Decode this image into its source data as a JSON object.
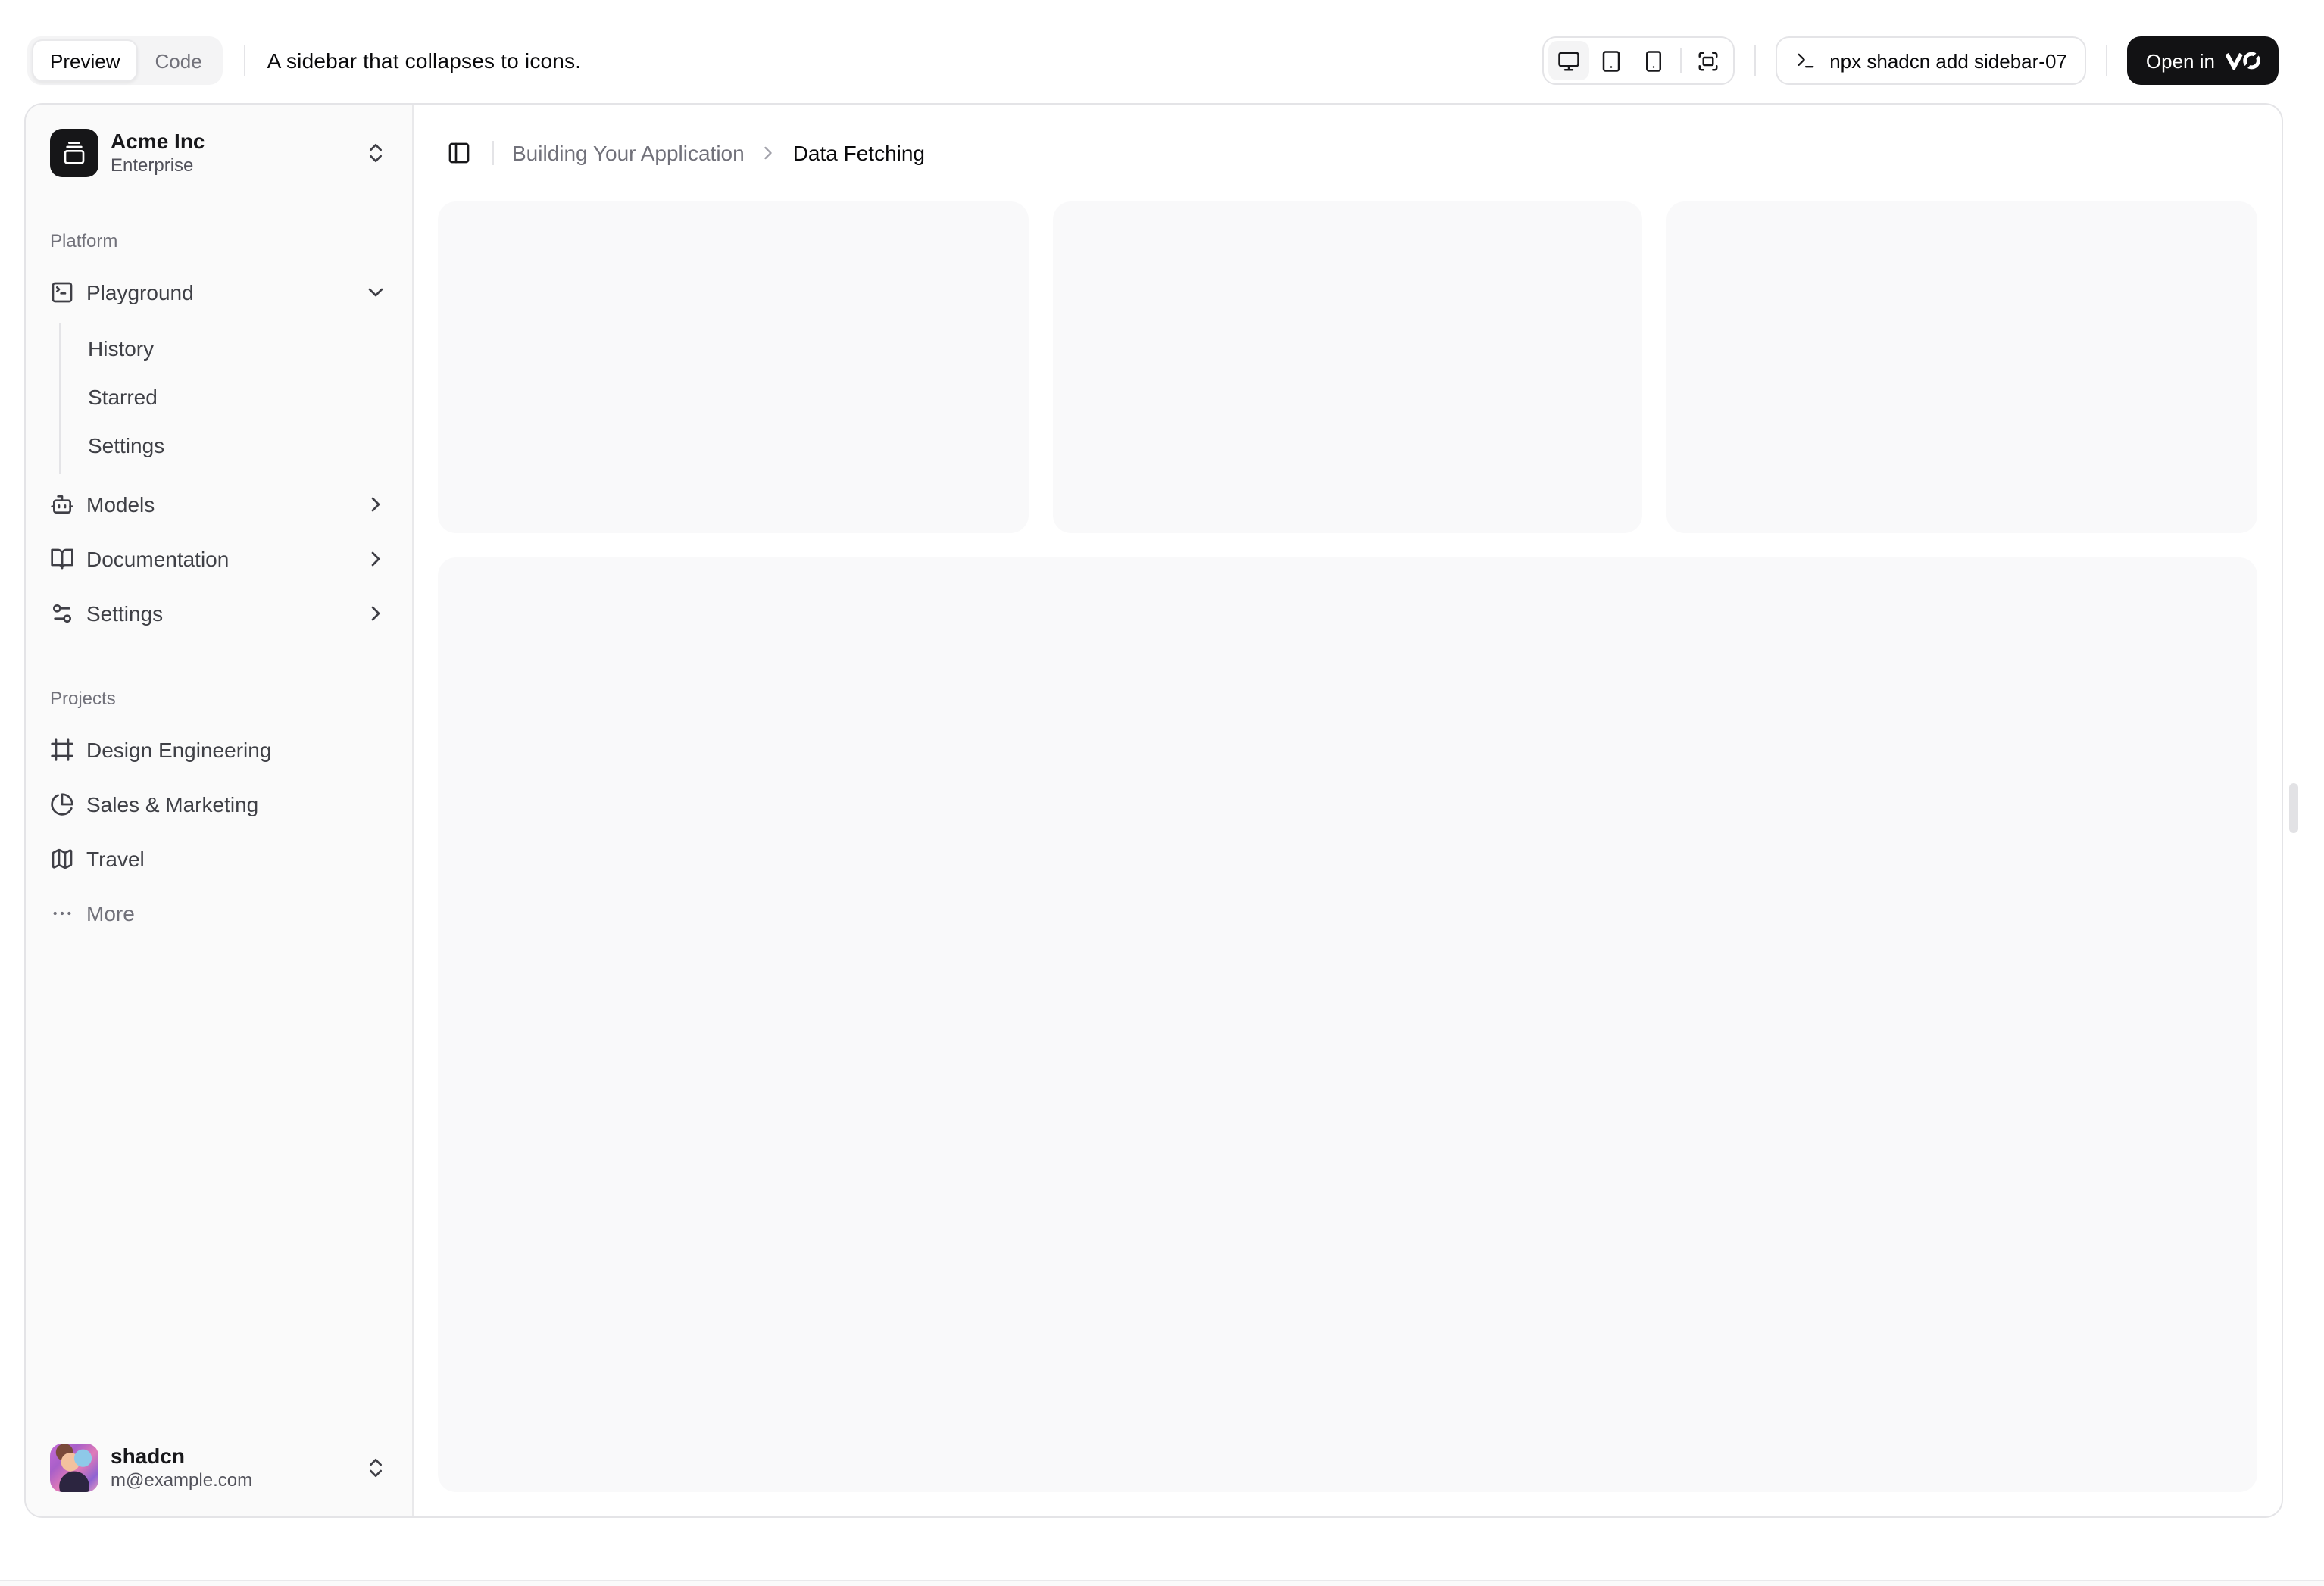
{
  "toolbar": {
    "tabs": {
      "preview": "Preview",
      "code": "Code"
    },
    "description": "A sidebar that collapses to icons.",
    "command": "npx shadcn add sidebar-07",
    "open_in_label": "Open in"
  },
  "breadcrumb": {
    "parent": "Building Your Application",
    "current": "Data Fetching"
  },
  "sidebar": {
    "team": {
      "name": "Acme Inc",
      "plan": "Enterprise"
    },
    "groups": [
      {
        "label": "Platform",
        "items": [
          {
            "label": "Playground",
            "icon": "square-terminal-icon",
            "sub": [
              "History",
              "Starred",
              "Settings"
            ]
          },
          {
            "label": "Models",
            "icon": "bot-icon"
          },
          {
            "label": "Documentation",
            "icon": "book-open-icon"
          },
          {
            "label": "Settings",
            "icon": "sliders-icon"
          }
        ]
      },
      {
        "label": "Projects",
        "items": [
          {
            "label": "Design Engineering",
            "icon": "frame-icon"
          },
          {
            "label": "Sales & Marketing",
            "icon": "pie-chart-icon"
          },
          {
            "label": "Travel",
            "icon": "map-icon"
          },
          {
            "label": "More",
            "icon": "ellipsis-icon"
          }
        ]
      }
    ],
    "user": {
      "name": "shadcn",
      "email": "m@example.com"
    }
  },
  "colors": {
    "primary": "#121214",
    "sidebar_bg": "#fafafa",
    "border": "#e4e4e7",
    "muted_text": "#71717a",
    "placeholder_bg": "#f9f9fa"
  }
}
